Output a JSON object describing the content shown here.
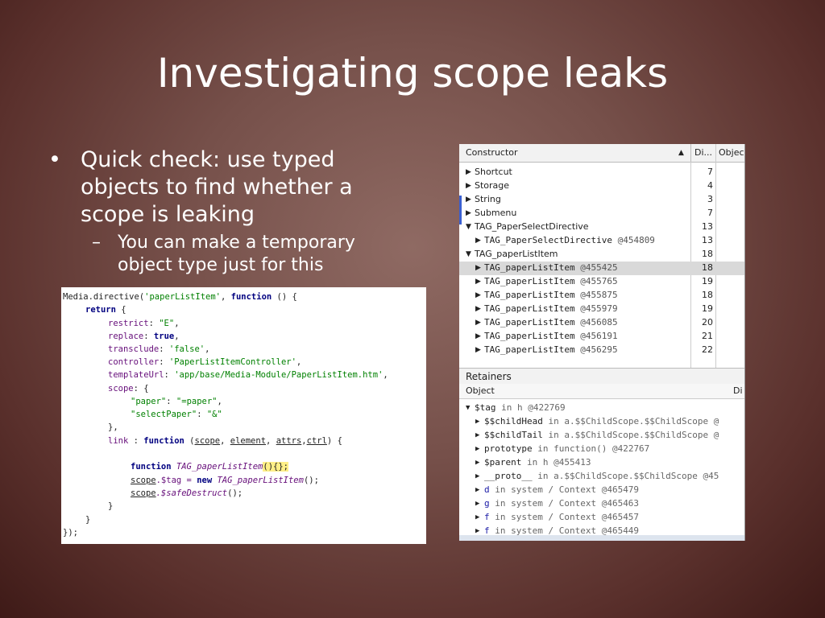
{
  "title": "Investigating scope leaks",
  "bullets": {
    "main": "Quick check: use typed objects to find whether a scope is leaking",
    "sub": "You can make a temporary object type just for this"
  },
  "devtools": {
    "headers": {
      "constructor": "Constructor",
      "distance": "Di...",
      "object": "Objec"
    },
    "rows": [
      {
        "name": "Shortcut",
        "dist": "7"
      },
      {
        "name": "Storage",
        "dist": "4"
      },
      {
        "name": "String",
        "dist": "3"
      },
      {
        "name": "Submenu",
        "dist": "7"
      },
      {
        "name": "TAG_PaperSelectDirective",
        "dist": "13"
      },
      {
        "name": "TAG_PaperSelectDirective",
        "id": "@454809",
        "dist": "13"
      },
      {
        "name": "TAG_paperListItem",
        "dist": "18"
      },
      {
        "name": "TAG_paperListItem",
        "id": "@455425",
        "dist": "18"
      },
      {
        "name": "TAG_paperListItem",
        "id": "@455765",
        "dist": "19"
      },
      {
        "name": "TAG_paperListItem",
        "id": "@455875",
        "dist": "18"
      },
      {
        "name": "TAG_paperListItem",
        "id": "@455979",
        "dist": "19"
      },
      {
        "name": "TAG_paperListItem",
        "id": "@456085",
        "dist": "20"
      },
      {
        "name": "TAG_paperListItem",
        "id": "@456191",
        "dist": "21"
      },
      {
        "name": "TAG_paperListItem",
        "id": "@456295",
        "dist": "22"
      }
    ],
    "retainers": {
      "title": "Retainers",
      "headers": {
        "object": "Object",
        "distance": "Di"
      },
      "rows": [
        {
          "key": "$tag",
          "rest": " in h @422769"
        },
        {
          "key": "$$childHead",
          "rest": " in a.$$ChildScope.$$ChildScope @"
        },
        {
          "key": "$$childTail",
          "rest": " in a.$$ChildScope.$$ChildScope @"
        },
        {
          "key": "prototype",
          "rest": " in function() @422767"
        },
        {
          "key": "$parent",
          "rest": " in h @455413"
        },
        {
          "key": "__proto__",
          "rest": " in a.$$ChildScope.$$ChildScope @45"
        },
        {
          "key": "d",
          "rest": " in system / Context @465479"
        },
        {
          "key": "g",
          "rest": " in system / Context @465463"
        },
        {
          "key": "f",
          "rest": " in system / Context @465457"
        },
        {
          "key": "f",
          "rest": " in system / Context @465449"
        }
      ]
    }
  },
  "code": {
    "l1a": "Media.directive(",
    "l1b": "'paperListItem'",
    "l1c": ", ",
    "l1d": "function",
    "l1e": " () {",
    "l2": "return",
    "l2b": " {",
    "l3k": "restrict",
    "l3v": "\"E\"",
    "l4k": "replace",
    "l4v": "true",
    "l5k": "transclude",
    "l5v": "'false'",
    "l6k": "controller",
    "l6v": "'PaperListItemController'",
    "l7k": "templateUrl",
    "l7v": "'app/base/Media-Module/PaperListItem.htm'",
    "l8k": "scope",
    "l8v": " {",
    "l9k": "\"paper\"",
    "l9v": "\"=paper\"",
    "l10k": "\"selectPaper\"",
    "l10v": "\"&\"",
    "l11": "},",
    "l12k": "link",
    "l12a": " : ",
    "l12f": "function",
    "l12p1": "scope",
    "l12p2": "element",
    "l12p3": "attrs",
    "l12p4": "ctrl",
    "l13f": "function",
    "l13n": "TAG_paperListItem",
    "l13b": "(){}",
    "l14a": "scope",
    "l14b": ".$tag = ",
    "l14c": "new",
    "l14d": "TAG_paperListItem",
    "l14e": "();",
    "l15a": "scope",
    "l15b": ".$safeDestruct",
    "l15c": "();",
    "l16": "}",
    "l17": "}",
    "l18": "});"
  }
}
